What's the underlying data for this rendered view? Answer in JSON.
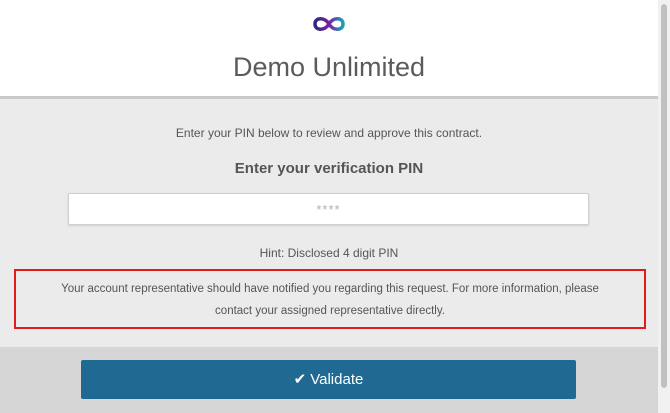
{
  "header": {
    "logo_icon": "infinity-icon",
    "title": "Demo Unlimited"
  },
  "main": {
    "instruction": "Enter your PIN below to review and approve this contract.",
    "pin_heading": "Enter your verification PIN",
    "pin_input": {
      "value": "",
      "placeholder": "****"
    },
    "hint": "Hint: Disclosed 4 digit PIN",
    "notice_line1": "Your account representative should have notified you regarding this request. For more information, please",
    "notice_line2": "contact your assigned representative directly."
  },
  "footer": {
    "validate_label": "Validate",
    "validate_icon": "check-icon"
  },
  "colors": {
    "accent": "#1f6993",
    "notice_border": "#e31b1b",
    "logo_gradient": [
      "#2c2a7a",
      "#7b1fa2",
      "#16a3b8"
    ]
  }
}
